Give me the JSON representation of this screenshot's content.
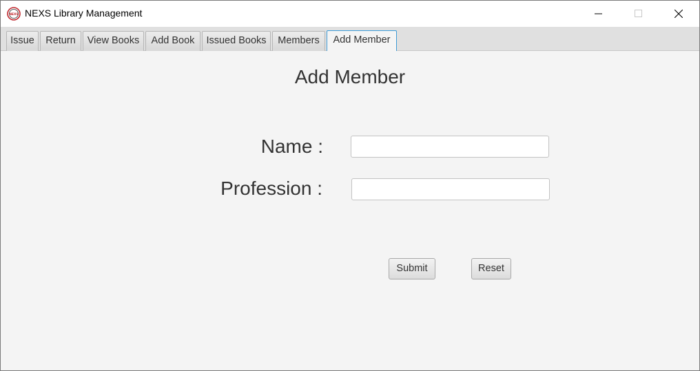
{
  "window": {
    "title": "NEXS Library Management",
    "app_icon_text": "NEXS"
  },
  "tabs": [
    {
      "label": "Issue",
      "selected": false
    },
    {
      "label": "Return",
      "selected": false
    },
    {
      "label": "View Books",
      "selected": false
    },
    {
      "label": "Add Book",
      "selected": false
    },
    {
      "label": "Issued Books",
      "selected": false
    },
    {
      "label": "Members",
      "selected": false
    },
    {
      "label": "Add Member",
      "selected": true
    }
  ],
  "form": {
    "title": "Add Member",
    "name_label": "Name :",
    "name_value": "",
    "profession_label": "Profession :",
    "profession_value": "",
    "submit_label": "Submit",
    "reset_label": "Reset"
  },
  "colors": {
    "selected_tab_border": "#3c9ad6",
    "icon_red": "#c0272d"
  }
}
